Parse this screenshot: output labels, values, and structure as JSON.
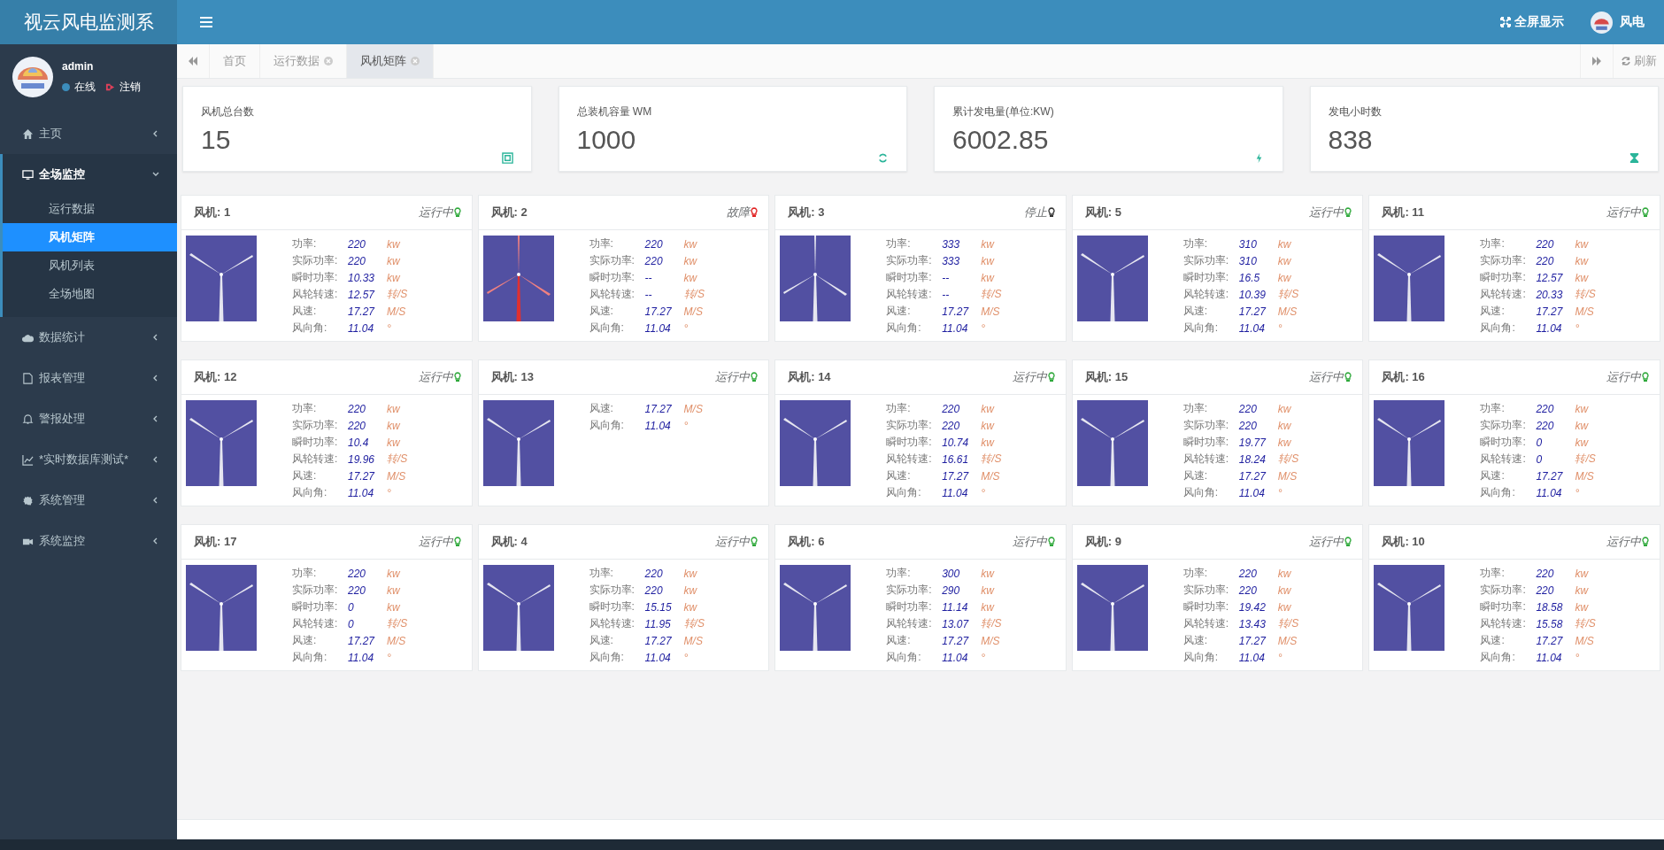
{
  "brand": "视云风电监测系",
  "header": {
    "fullscreen": "全屏显示",
    "user": "风电"
  },
  "user_panel": {
    "name": "admin",
    "status": "在线",
    "logout": "注销"
  },
  "sidebar": {
    "items": [
      {
        "label": "主页",
        "expanded": false
      },
      {
        "label": "全场监控",
        "expanded": true,
        "children": [
          {
            "label": "运行数据",
            "selected": false
          },
          {
            "label": "风机矩阵",
            "selected": true
          },
          {
            "label": "风机列表",
            "selected": false
          },
          {
            "label": "全场地图",
            "selected": false
          }
        ]
      },
      {
        "label": "数据统计",
        "expanded": false
      },
      {
        "label": "报表管理",
        "expanded": false
      },
      {
        "label": "警报处理",
        "expanded": false
      },
      {
        "label": "*实时数据库测试*",
        "expanded": false
      },
      {
        "label": "系统管理",
        "expanded": false
      },
      {
        "label": "系统监控",
        "expanded": false
      }
    ]
  },
  "tabs": [
    {
      "label": "首页",
      "selected": false,
      "closable": false
    },
    {
      "label": "运行数据",
      "selected": false,
      "closable": true
    },
    {
      "label": "风机矩阵",
      "selected": true,
      "closable": true
    }
  ],
  "refresh": "刷新",
  "stats": [
    {
      "label": "风机总台数",
      "value": "15"
    },
    {
      "label": "总装机容量 WM",
      "value": "1000"
    },
    {
      "label": "累计发电量(单位:KW)",
      "value": "6002.85"
    },
    {
      "label": "发电小时数",
      "value": "838"
    }
  ],
  "turbines": [
    {
      "title": "风机: 1",
      "status": "运行中",
      "kind": "run",
      "rows": [
        {
          "label": "功率:",
          "value": "220",
          "unit": "kw"
        },
        {
          "label": "实际功率:",
          "value": "220",
          "unit": "kw"
        },
        {
          "label": "瞬时功率:",
          "value": "10.33",
          "unit": "kw"
        },
        {
          "label": "风轮转速:",
          "value": "12.57",
          "unit": "转/S"
        },
        {
          "label": "风速:",
          "value": "17.27",
          "unit": "M/S"
        },
        {
          "label": "风向角:",
          "value": "11.04",
          "unit": "°"
        }
      ]
    },
    {
      "title": "风机: 2",
      "status": "故障",
      "kind": "fault",
      "rows": [
        {
          "label": "功率:",
          "value": "220",
          "unit": "kw"
        },
        {
          "label": "实际功率:",
          "value": "220",
          "unit": "kw"
        },
        {
          "label": "瞬时功率:",
          "value": "--",
          "unit": "kw"
        },
        {
          "label": "风轮转速:",
          "value": "--",
          "unit": "转/S"
        },
        {
          "label": "风速:",
          "value": "17.27",
          "unit": "M/S"
        },
        {
          "label": "风向角:",
          "value": "11.04",
          "unit": "°"
        }
      ]
    },
    {
      "title": "风机: 3",
      "status": "停止",
      "kind": "stop",
      "rows": [
        {
          "label": "功率:",
          "value": "333",
          "unit": "kw"
        },
        {
          "label": "实际功率:",
          "value": "333",
          "unit": "kw"
        },
        {
          "label": "瞬时功率:",
          "value": "--",
          "unit": "kw"
        },
        {
          "label": "风轮转速:",
          "value": "--",
          "unit": "转/S"
        },
        {
          "label": "风速:",
          "value": "17.27",
          "unit": "M/S"
        },
        {
          "label": "风向角:",
          "value": "11.04",
          "unit": "°"
        }
      ]
    },
    {
      "title": "风机: 5",
      "status": "运行中",
      "kind": "run",
      "rows": [
        {
          "label": "功率:",
          "value": "310",
          "unit": "kw"
        },
        {
          "label": "实际功率:",
          "value": "310",
          "unit": "kw"
        },
        {
          "label": "瞬时功率:",
          "value": "16.5",
          "unit": "kw"
        },
        {
          "label": "风轮转速:",
          "value": "10.39",
          "unit": "转/S"
        },
        {
          "label": "风速:",
          "value": "17.27",
          "unit": "M/S"
        },
        {
          "label": "风向角:",
          "value": "11.04",
          "unit": "°"
        }
      ]
    },
    {
      "title": "风机: 11",
      "status": "运行中",
      "kind": "run",
      "rows": [
        {
          "label": "功率:",
          "value": "220",
          "unit": "kw"
        },
        {
          "label": "实际功率:",
          "value": "220",
          "unit": "kw"
        },
        {
          "label": "瞬时功率:",
          "value": "12.57",
          "unit": "kw"
        },
        {
          "label": "风轮转速:",
          "value": "20.33",
          "unit": "转/S"
        },
        {
          "label": "风速:",
          "value": "17.27",
          "unit": "M/S"
        },
        {
          "label": "风向角:",
          "value": "11.04",
          "unit": "°"
        }
      ]
    },
    {
      "title": "风机: 12",
      "status": "运行中",
      "kind": "run",
      "rows": [
        {
          "label": "功率:",
          "value": "220",
          "unit": "kw"
        },
        {
          "label": "实际功率:",
          "value": "220",
          "unit": "kw"
        },
        {
          "label": "瞬时功率:",
          "value": "10.4",
          "unit": "kw"
        },
        {
          "label": "风轮转速:",
          "value": "19.96",
          "unit": "转/S"
        },
        {
          "label": "风速:",
          "value": "17.27",
          "unit": "M/S"
        },
        {
          "label": "风向角:",
          "value": "11.04",
          "unit": "°"
        }
      ]
    },
    {
      "title": "风机: 13",
      "status": "运行中",
      "kind": "run",
      "rows": [
        {
          "label": "风速:",
          "value": "17.27",
          "unit": "M/S"
        },
        {
          "label": "风向角:",
          "value": "11.04",
          "unit": "°"
        }
      ]
    },
    {
      "title": "风机: 14",
      "status": "运行中",
      "kind": "run",
      "rows": [
        {
          "label": "功率:",
          "value": "220",
          "unit": "kw"
        },
        {
          "label": "实际功率:",
          "value": "220",
          "unit": "kw"
        },
        {
          "label": "瞬时功率:",
          "value": "10.74",
          "unit": "kw"
        },
        {
          "label": "风轮转速:",
          "value": "16.61",
          "unit": "转/S"
        },
        {
          "label": "风速:",
          "value": "17.27",
          "unit": "M/S"
        },
        {
          "label": "风向角:",
          "value": "11.04",
          "unit": "°"
        }
      ]
    },
    {
      "title": "风机: 15",
      "status": "运行中",
      "kind": "run",
      "rows": [
        {
          "label": "功率:",
          "value": "220",
          "unit": "kw"
        },
        {
          "label": "实际功率:",
          "value": "220",
          "unit": "kw"
        },
        {
          "label": "瞬时功率:",
          "value": "19.77",
          "unit": "kw"
        },
        {
          "label": "风轮转速:",
          "value": "18.24",
          "unit": "转/S"
        },
        {
          "label": "风速:",
          "value": "17.27",
          "unit": "M/S"
        },
        {
          "label": "风向角:",
          "value": "11.04",
          "unit": "°"
        }
      ]
    },
    {
      "title": "风机: 16",
      "status": "运行中",
      "kind": "run",
      "rows": [
        {
          "label": "功率:",
          "value": "220",
          "unit": "kw"
        },
        {
          "label": "实际功率:",
          "value": "220",
          "unit": "kw"
        },
        {
          "label": "瞬时功率:",
          "value": "0",
          "unit": "kw"
        },
        {
          "label": "风轮转速:",
          "value": "0",
          "unit": "转/S"
        },
        {
          "label": "风速:",
          "value": "17.27",
          "unit": "M/S"
        },
        {
          "label": "风向角:",
          "value": "11.04",
          "unit": "°"
        }
      ]
    },
    {
      "title": "风机: 17",
      "status": "运行中",
      "kind": "run",
      "rows": [
        {
          "label": "功率:",
          "value": "220",
          "unit": "kw"
        },
        {
          "label": "实际功率:",
          "value": "220",
          "unit": "kw"
        },
        {
          "label": "瞬时功率:",
          "value": "0",
          "unit": "kw"
        },
        {
          "label": "风轮转速:",
          "value": "0",
          "unit": "转/S"
        },
        {
          "label": "风速:",
          "value": "17.27",
          "unit": "M/S"
        },
        {
          "label": "风向角:",
          "value": "11.04",
          "unit": "°"
        }
      ]
    },
    {
      "title": "风机: 4",
      "status": "运行中",
      "kind": "run",
      "rows": [
        {
          "label": "功率:",
          "value": "220",
          "unit": "kw"
        },
        {
          "label": "实际功率:",
          "value": "220",
          "unit": "kw"
        },
        {
          "label": "瞬时功率:",
          "value": "15.15",
          "unit": "kw"
        },
        {
          "label": "风轮转速:",
          "value": "11.95",
          "unit": "转/S"
        },
        {
          "label": "风速:",
          "value": "17.27",
          "unit": "M/S"
        },
        {
          "label": "风向角:",
          "value": "11.04",
          "unit": "°"
        }
      ]
    },
    {
      "title": "风机: 6",
      "status": "运行中",
      "kind": "run",
      "rows": [
        {
          "label": "功率:",
          "value": "300",
          "unit": "kw"
        },
        {
          "label": "实际功率:",
          "value": "290",
          "unit": "kw"
        },
        {
          "label": "瞬时功率:",
          "value": "11.14",
          "unit": "kw"
        },
        {
          "label": "风轮转速:",
          "value": "13.07",
          "unit": "转/S"
        },
        {
          "label": "风速:",
          "value": "17.27",
          "unit": "M/S"
        },
        {
          "label": "风向角:",
          "value": "11.04",
          "unit": "°"
        }
      ]
    },
    {
      "title": "风机: 9",
      "status": "运行中",
      "kind": "run",
      "rows": [
        {
          "label": "功率:",
          "value": "220",
          "unit": "kw"
        },
        {
          "label": "实际功率:",
          "value": "220",
          "unit": "kw"
        },
        {
          "label": "瞬时功率:",
          "value": "19.42",
          "unit": "kw"
        },
        {
          "label": "风轮转速:",
          "value": "13.43",
          "unit": "转/S"
        },
        {
          "label": "风速:",
          "value": "17.27",
          "unit": "M/S"
        },
        {
          "label": "风向角:",
          "value": "11.04",
          "unit": "°"
        }
      ]
    },
    {
      "title": "风机: 10",
      "status": "运行中",
      "kind": "run",
      "rows": [
        {
          "label": "功率:",
          "value": "220",
          "unit": "kw"
        },
        {
          "label": "实际功率:",
          "value": "220",
          "unit": "kw"
        },
        {
          "label": "瞬时功率:",
          "value": "18.58",
          "unit": "kw"
        },
        {
          "label": "风轮转速:",
          "value": "15.58",
          "unit": "转/S"
        },
        {
          "label": "风速:",
          "value": "17.27",
          "unit": "M/S"
        },
        {
          "label": "风向角:",
          "value": "11.04",
          "unit": "°"
        }
      ]
    }
  ]
}
